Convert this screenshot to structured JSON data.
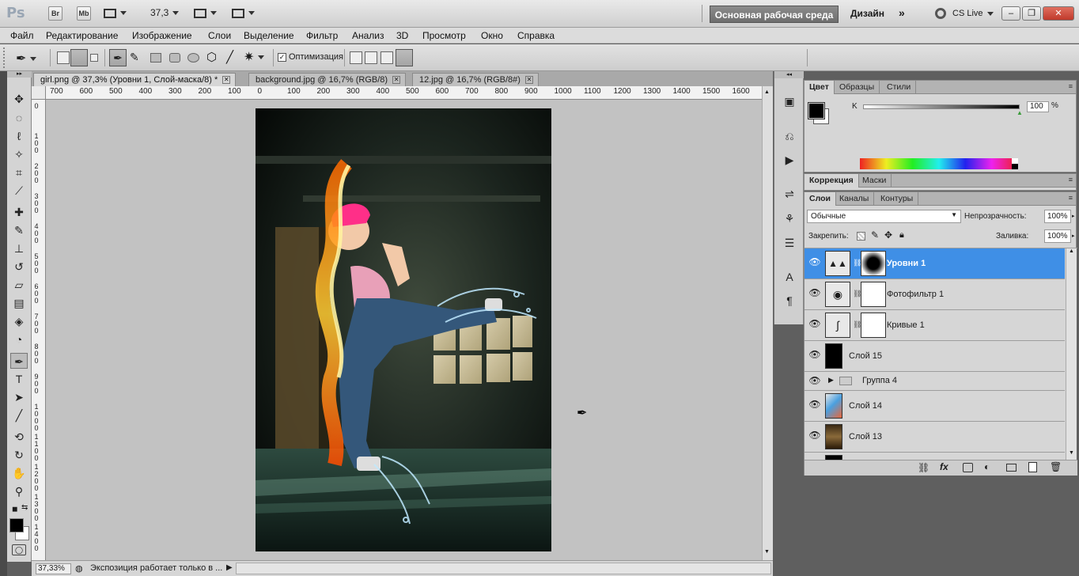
{
  "appbar": {
    "logo": "Ps",
    "bridge": "Br",
    "minibridge": "Mb",
    "zoom": "37,3",
    "workspace_active": "Основная рабочая среда",
    "workspace_design": "Дизайн",
    "cs_live": "CS Live"
  },
  "menu": [
    "Файл",
    "Редактирование",
    "Изображение",
    "Слои",
    "Выделение",
    "Фильтр",
    "Анализ",
    "3D",
    "Просмотр",
    "Окно",
    "Справка"
  ],
  "options": {
    "optimize_label": "Оптимизация",
    "optimize_checked": true
  },
  "tabs": [
    {
      "label": "girl.png @ 37,3% (Уровни 1, Слой-маска/8) *"
    },
    {
      "label": "background.jpg @ 16,7% (RGB/8)"
    },
    {
      "label": "12.jpg @ 16,7% (RGB/8#)"
    }
  ],
  "ruler_h": [
    "700",
    "600",
    "500",
    "400",
    "300",
    "200",
    "100",
    "0",
    "100",
    "200",
    "300",
    "400",
    "500",
    "600",
    "700",
    "800",
    "900",
    "1000",
    "1100",
    "1200",
    "1300",
    "1400",
    "1500",
    "1600"
  ],
  "ruler_v": [
    "0",
    "1 0 0",
    "2 0 0",
    "3 0 0",
    "4 0 0",
    "5 0 0",
    "6 0 0",
    "7 0 0",
    "8 0 0",
    "9 0 0",
    "1 0 0 0",
    "1 1 0 0",
    "1 2 0 0",
    "1 3 0 0",
    "1 4 0 0"
  ],
  "status": {
    "zoom": "37,33%",
    "info": "Экспозиция работает только в ..."
  },
  "color_panel": {
    "tabs": [
      "Цвет",
      "Образцы",
      "Стили"
    ],
    "channel": "K",
    "value": "100",
    "unit": "%",
    "foreground": "#000000",
    "background": "#ffffff"
  },
  "adjust_panel": {
    "tabs": [
      "Коррекция",
      "Маски"
    ]
  },
  "layers_panel": {
    "tabs": [
      "Слои",
      "Каналы",
      "Контуры"
    ],
    "blend_mode": "Обычные",
    "opacity_label": "Непрозрачность:",
    "opacity": "100%",
    "lock_label": "Закрепить:",
    "fill_label": "Заливка:",
    "fill": "100%",
    "layers": [
      {
        "name": "Уровни 1",
        "selected": true,
        "kind": "adjustment",
        "icon": "levels-icon"
      },
      {
        "name": "Фотофильтр 1",
        "selected": false,
        "kind": "adjustment",
        "icon": "photo-filter-icon"
      },
      {
        "name": "Кривые 1",
        "selected": false,
        "kind": "adjustment",
        "icon": "curves-icon"
      },
      {
        "name": "Слой 15",
        "selected": false,
        "kind": "pixel"
      },
      {
        "name": "Группа 4",
        "selected": false,
        "kind": "group"
      },
      {
        "name": "Слой 14",
        "selected": false,
        "kind": "pixel"
      },
      {
        "name": "Слой 13",
        "selected": false,
        "kind": "pixel"
      }
    ]
  },
  "colors": {
    "selection": "#3f8fe6",
    "workspace": "#5f5f5f",
    "canvas": "#c2c2c2"
  }
}
